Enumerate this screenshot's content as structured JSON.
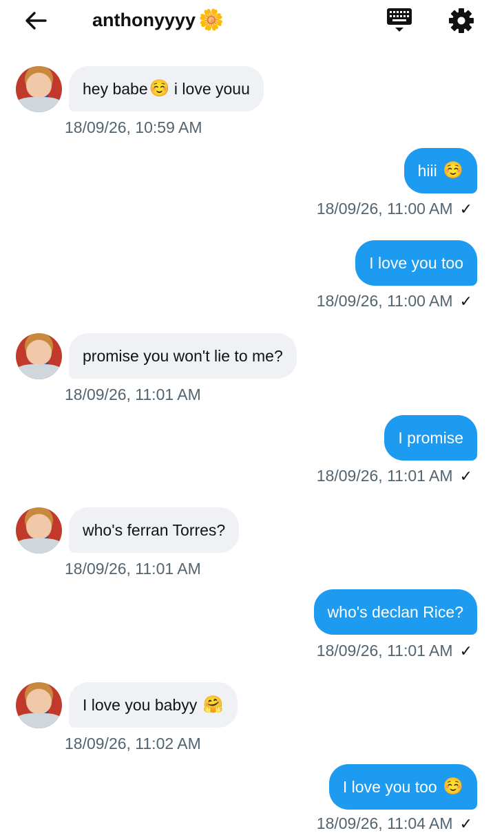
{
  "header": {
    "back_icon": "back-arrow-icon",
    "title": "anthonyyyy",
    "title_emoji": "🌼",
    "keyboard_icon": "keyboard-icon",
    "settings_icon": "gear-icon"
  },
  "messages": [
    {
      "dir": "in",
      "text": "hey babe",
      "emoji_mid": "☺️",
      "text2": "i love youu",
      "timestamp": "18/09/26, 10:59 AM"
    },
    {
      "dir": "out",
      "text": "hiii",
      "emoji": "☺️",
      "timestamp": "18/09/26, 11:00 AM",
      "status": "✓"
    },
    {
      "dir": "out",
      "text": "I love you too",
      "timestamp": "18/09/26, 11:00 AM",
      "status": "✓"
    },
    {
      "dir": "in",
      "text": "promise you won't lie to me?",
      "timestamp": "18/09/26, 11:01 AM"
    },
    {
      "dir": "out",
      "text": "I promise",
      "timestamp": "18/09/26, 11:01 AM",
      "status": "✓"
    },
    {
      "dir": "in",
      "text": "who's ferran Torres?",
      "timestamp": "18/09/26, 11:01 AM"
    },
    {
      "dir": "out",
      "text": "who's declan Rice?",
      "timestamp": "18/09/26, 11:01 AM",
      "status": "✓"
    },
    {
      "dir": "in",
      "text": "I love you babyy",
      "emoji": "🤗",
      "timestamp": "18/09/26, 11:02 AM"
    },
    {
      "dir": "out",
      "text": "I love you too",
      "emoji": "☺️",
      "timestamp": "18/09/26, 11:04 AM",
      "status": "✓"
    }
  ],
  "colors": {
    "outgoing": "#1d9bf0",
    "incoming": "#eff1f4",
    "timestamp": "#536471"
  }
}
